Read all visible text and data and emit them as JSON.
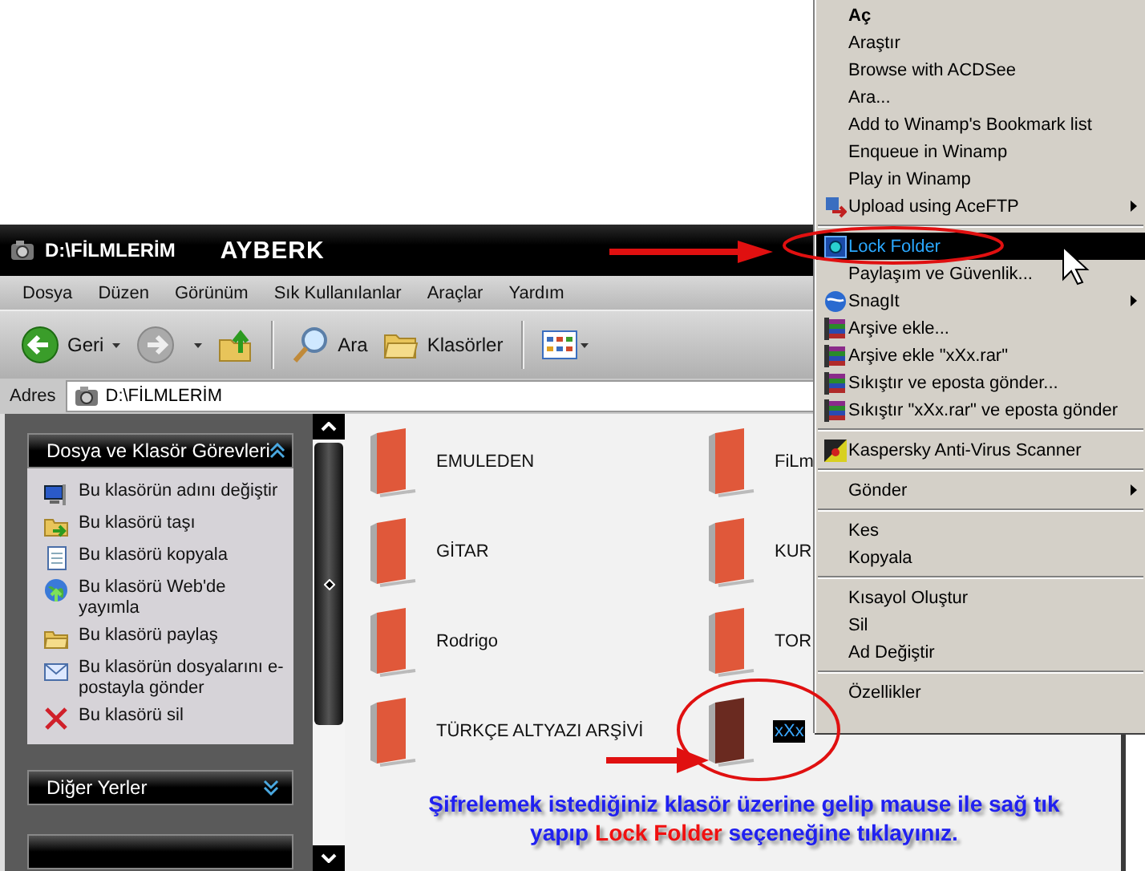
{
  "window": {
    "title": "D:\\FİLMLERİM",
    "user": "AYBERK"
  },
  "menu_bar": [
    "Dosya",
    "Düzen",
    "Görünüm",
    "Sık Kullanılanlar",
    "Araçlar",
    "Yardım"
  ],
  "toolbar": [
    {
      "kind": "back",
      "label": "Geri",
      "disabled": false
    },
    {
      "kind": "forward",
      "disabled": true
    },
    {
      "kind": "up"
    },
    {
      "kind": "separator"
    },
    {
      "kind": "search",
      "label": "Ara"
    },
    {
      "kind": "folders",
      "label": "Klasörler"
    },
    {
      "kind": "separator"
    },
    {
      "kind": "views"
    }
  ],
  "address_bar": {
    "label": "Adres",
    "value": "D:\\FİLMLERİM"
  },
  "task_panels": [
    {
      "title": "Dosya ve Klasör Görevleri",
      "expanded": true,
      "items": [
        {
          "label": "Bu klasörün adını değiştir"
        },
        {
          "label": "Bu klasörü taşı"
        },
        {
          "label": "Bu klasörü kopyala"
        },
        {
          "label": "Bu klasörü Web'de yayımla"
        },
        {
          "label": "Bu klasörü paylaş"
        },
        {
          "label": "Bu klasörün dosyalarını e-postayla gönder"
        },
        {
          "label": "Bu klasörü sil"
        }
      ]
    },
    {
      "title": "Diğer Yerler",
      "expanded": false
    }
  ],
  "folders": [
    {
      "name": "EMULEDEN",
      "selected": false
    },
    {
      "name": "FiLm",
      "selected": false
    },
    {
      "name": "GİTAR",
      "selected": false
    },
    {
      "name": "KUR",
      "selected": false
    },
    {
      "name": "Rodrigo",
      "selected": false
    },
    {
      "name": "TOR",
      "selected": false
    },
    {
      "name": "TÜRKÇE ALTYAZI ARŞİVİ",
      "selected": false
    },
    {
      "name": "xXx",
      "selected": true
    }
  ],
  "caption": [
    [
      {
        "text": "Şifrelemek istediğiniz klasör üzerine gelip mause ile sağ tık",
        "highlight": false
      }
    ],
    [
      {
        "text": "yapıp ",
        "highlight": false
      },
      {
        "text": "Lock Folder",
        "highlight": true
      },
      {
        "text": " seçeneğine tıklayınız.",
        "highlight": false
      }
    ]
  ],
  "context_menu": [
    {
      "kind": "item",
      "label": "Aç",
      "default": true,
      "selected": false,
      "submenu": false
    },
    {
      "kind": "item",
      "label": "Araştır",
      "default": false,
      "selected": false,
      "submenu": false
    },
    {
      "kind": "item",
      "label": "Browse with ACDSee",
      "default": false,
      "selected": false,
      "submenu": false
    },
    {
      "kind": "item",
      "label": "Ara...",
      "default": false,
      "selected": false,
      "submenu": false
    },
    {
      "kind": "item",
      "label": "Add to Winamp's Bookmark list",
      "default": false,
      "selected": false,
      "submenu": false
    },
    {
      "kind": "item",
      "label": "Enqueue in Winamp",
      "default": false,
      "selected": false,
      "submenu": false
    },
    {
      "kind": "item",
      "label": "Play in Winamp",
      "default": false,
      "selected": false,
      "submenu": false
    },
    {
      "kind": "item",
      "label": "Upload using AceFTP",
      "default": false,
      "selected": false,
      "submenu": true
    },
    {
      "kind": "separator"
    },
    {
      "kind": "item",
      "label": "Lock Folder",
      "default": false,
      "selected": true,
      "submenu": false
    },
    {
      "kind": "item",
      "label": "Paylaşım ve Güvenlik...",
      "default": false,
      "selected": false,
      "submenu": false
    },
    {
      "kind": "item",
      "label": "SnagIt",
      "default": false,
      "selected": false,
      "submenu": true
    },
    {
      "kind": "item",
      "label": "Arşive ekle...",
      "default": false,
      "selected": false,
      "submenu": false
    },
    {
      "kind": "item",
      "label": "Arşive ekle \"xXx.rar\"",
      "default": false,
      "selected": false,
      "submenu": false
    },
    {
      "kind": "item",
      "label": "Sıkıştır ve eposta gönder...",
      "default": false,
      "selected": false,
      "submenu": false
    },
    {
      "kind": "item",
      "label": "Sıkıştır \"xXx.rar\" ve eposta gönder",
      "default": false,
      "selected": false,
      "submenu": false
    },
    {
      "kind": "separator"
    },
    {
      "kind": "item",
      "label": "Kaspersky Anti-Virus Scanner",
      "default": false,
      "selected": false,
      "submenu": false
    },
    {
      "kind": "separator"
    },
    {
      "kind": "item",
      "label": "Gönder",
      "default": false,
      "selected": false,
      "submenu": true
    },
    {
      "kind": "separator"
    },
    {
      "kind": "item",
      "label": "Kes",
      "default": false,
      "selected": false,
      "submenu": false
    },
    {
      "kind": "item",
      "label": "Kopyala",
      "default": false,
      "selected": false,
      "submenu": false
    },
    {
      "kind": "separator"
    },
    {
      "kind": "item",
      "label": "Kısayol Oluştur",
      "default": false,
      "selected": false,
      "submenu": false
    },
    {
      "kind": "item",
      "label": "Sil",
      "default": false,
      "selected": false,
      "submenu": false
    },
    {
      "kind": "item",
      "label": "Ad Değiştir",
      "default": false,
      "selected": false,
      "submenu": false
    },
    {
      "kind": "separator"
    },
    {
      "kind": "item",
      "label": "Özellikler",
      "default": false,
      "selected": false,
      "submenu": false
    }
  ]
}
